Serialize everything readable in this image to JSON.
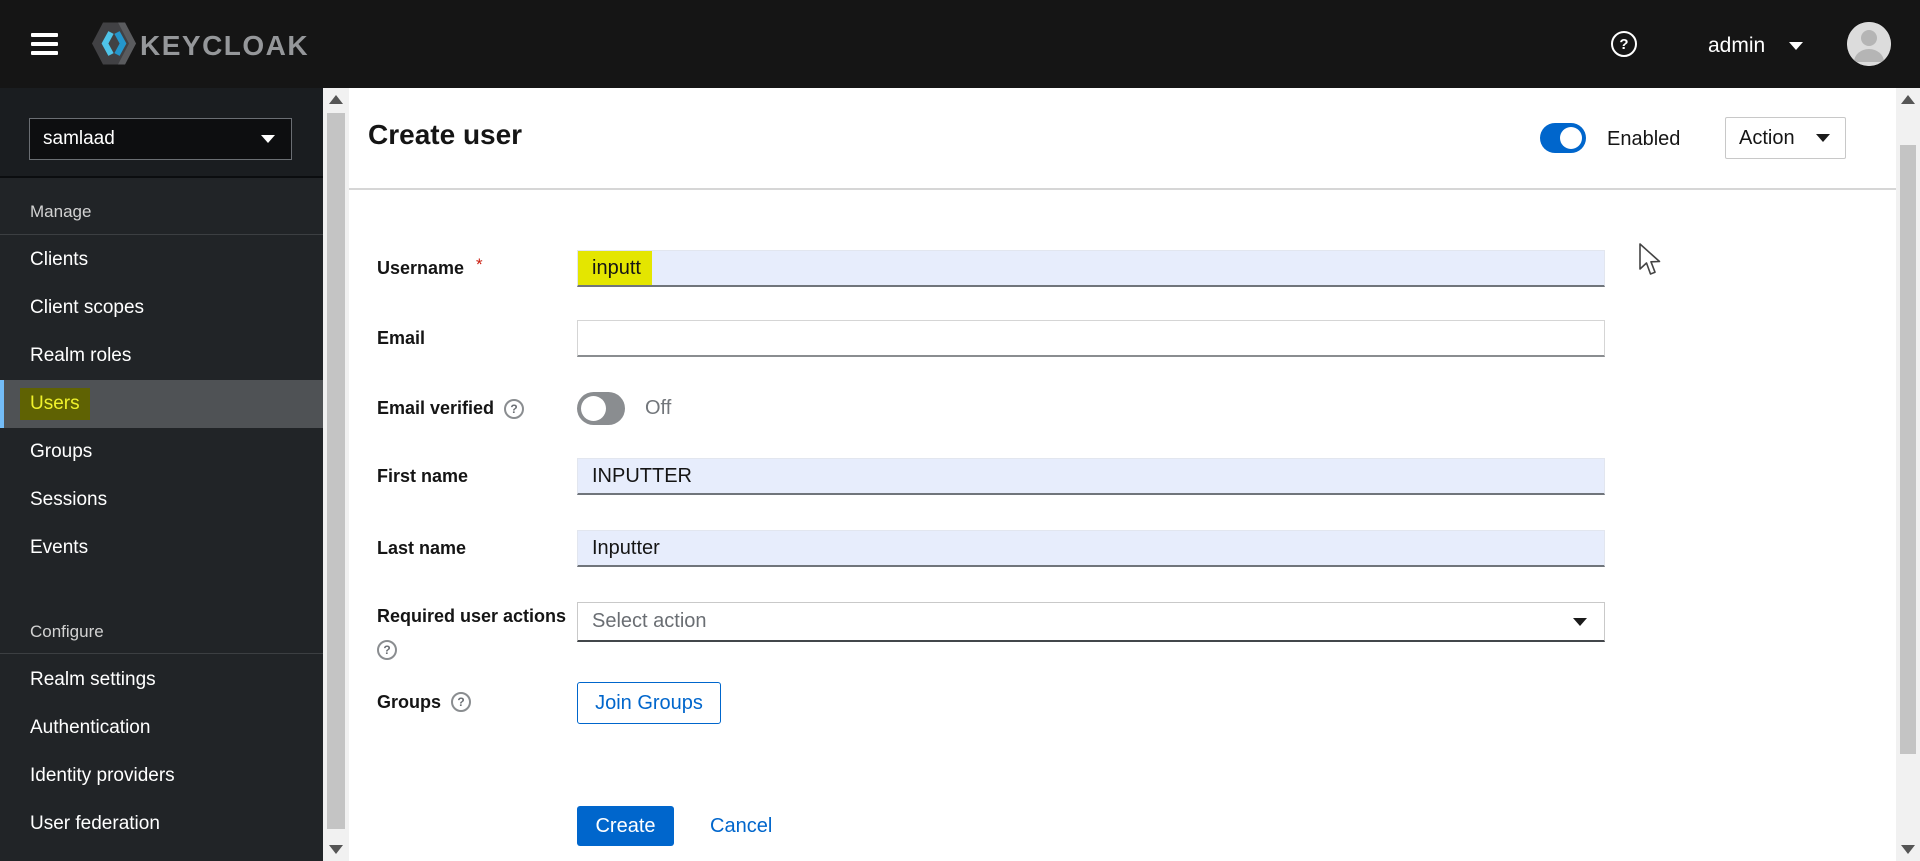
{
  "topbar": {
    "brand_text": "KEYCLOAK",
    "username": "admin"
  },
  "icons": {
    "question_mark": "?"
  },
  "sidebar": {
    "realm_selector": {
      "value": "samlaad"
    },
    "sections": [
      {
        "label": "Manage",
        "items": [
          {
            "label": "Clients",
            "selected": false
          },
          {
            "label": "Client scopes",
            "selected": false
          },
          {
            "label": "Realm roles",
            "selected": false
          },
          {
            "label": "Users",
            "selected": true,
            "highlighted": true
          },
          {
            "label": "Groups",
            "selected": false
          },
          {
            "label": "Sessions",
            "selected": false
          },
          {
            "label": "Events",
            "selected": false
          }
        ]
      },
      {
        "label": "Configure",
        "items": [
          {
            "label": "Realm settings",
            "selected": false
          },
          {
            "label": "Authentication",
            "selected": false
          },
          {
            "label": "Identity providers",
            "selected": false
          },
          {
            "label": "User federation",
            "selected": false
          }
        ]
      }
    ]
  },
  "main": {
    "title": "Create user",
    "enabled_toggle": {
      "label": "Enabled",
      "state": "on"
    },
    "action_dropdown": {
      "label": "Action"
    },
    "form": {
      "username": {
        "label": "Username",
        "required_marker": "*",
        "value": "inputt",
        "value_highlighted": true
      },
      "email": {
        "label": "Email",
        "value": ""
      },
      "email_verified": {
        "label": "Email verified",
        "state": "off",
        "state_label": "Off"
      },
      "first_name": {
        "label": "First name",
        "value": "INPUTTER"
      },
      "last_name": {
        "label": "Last name",
        "value": "Inputter"
      },
      "required_user_actions": {
        "label": "Required user actions",
        "placeholder": "Select action"
      },
      "groups": {
        "label": "Groups",
        "join_button_label": "Join Groups"
      }
    },
    "actions": {
      "create_label": "Create",
      "cancel_label": "Cancel"
    }
  },
  "colors": {
    "topbar_bg": "#151515",
    "sidebar_bg": "#212427",
    "accent_blue": "#0066cc",
    "toggle_off_gray": "#8a8d90",
    "highlight_yellow": "#e4e600",
    "nav_highlight_bg": "#5f6203",
    "nav_selected_bg": "#4f5255",
    "nav_selected_indicator": "#73bcf7",
    "autofill_input_bg": "#e7edfc",
    "required_red": "#c9190b"
  }
}
